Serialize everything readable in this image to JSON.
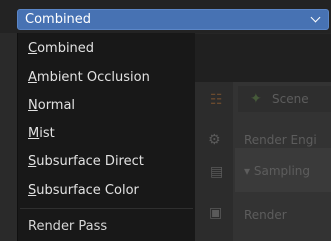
{
  "dropdown": {
    "selected": "Combined",
    "accent_color": "#4772b3",
    "chevron_icon": "chevron-down-icon"
  },
  "menu": {
    "items": [
      {
        "label": "Combined",
        "mnemonic": "C"
      },
      {
        "label": "Ambient Occlusion",
        "mnemonic": "A"
      },
      {
        "label": "Normal",
        "mnemonic": "N"
      },
      {
        "label": "Mist",
        "mnemonic": "M"
      },
      {
        "label": "Subsurface Direct",
        "mnemonic": "S"
      },
      {
        "label": "Subsurface Color",
        "mnemonic": "S"
      }
    ],
    "title": "Render Pass"
  },
  "background": {
    "scene_label": "Scene",
    "render_engine_label": "Render Engi",
    "sampling_label": "Sampling",
    "render_label": "Render"
  }
}
